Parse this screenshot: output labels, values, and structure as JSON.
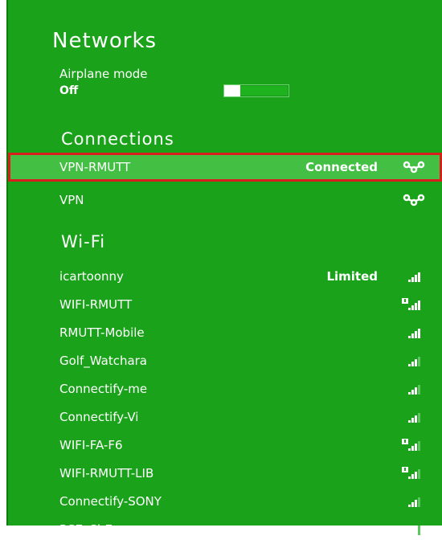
{
  "panel": {
    "title": "Networks",
    "airplane": {
      "label": "Airplane mode",
      "value": "Off"
    }
  },
  "connections": {
    "heading": "Connections",
    "items": [
      {
        "name": "VPN-RMUTT",
        "status": "Connected",
        "icon": "vpn-icon",
        "selected": true
      },
      {
        "name": "VPN",
        "status": "",
        "icon": "vpn-icon",
        "selected": false
      }
    ]
  },
  "wifi": {
    "heading": "Wi-Fi",
    "items": [
      {
        "name": "icartoonny",
        "status": "Limited",
        "icon": "wifi-signal-icon",
        "secured": false,
        "bars": 4
      },
      {
        "name": "WIFI-RMUTT",
        "status": "",
        "icon": "wifi-signal-warning-icon",
        "secured": true,
        "bars": 4
      },
      {
        "name": "RMUTT-Mobile",
        "status": "",
        "icon": "wifi-signal-icon",
        "secured": false,
        "bars": 4
      },
      {
        "name": "Golf_Watchara",
        "status": "",
        "icon": "wifi-signal-icon",
        "secured": false,
        "bars": 3
      },
      {
        "name": "Connectify-me",
        "status": "",
        "icon": "wifi-signal-icon",
        "secured": false,
        "bars": 3
      },
      {
        "name": "Connectify-Vi",
        "status": "",
        "icon": "wifi-signal-icon",
        "secured": false,
        "bars": 3
      },
      {
        "name": "WIFI-FA-F6",
        "status": "",
        "icon": "wifi-signal-warning-icon",
        "secured": true,
        "bars": 3
      },
      {
        "name": "WIFI-RMUTT-LIB",
        "status": "",
        "icon": "wifi-signal-warning-icon",
        "secured": true,
        "bars": 3
      },
      {
        "name": "Connectify-SONY",
        "status": "",
        "icon": "wifi-signal-icon",
        "secured": false,
        "bars": 3
      },
      {
        "name": "PCE_ChE",
        "status": "",
        "icon": "wifi-signal-icon",
        "secured": false,
        "bars": 3
      }
    ]
  },
  "colors": {
    "panel": "#1aa31a",
    "selected_row": "#43c043",
    "highlight_border": "#d91e1e"
  }
}
